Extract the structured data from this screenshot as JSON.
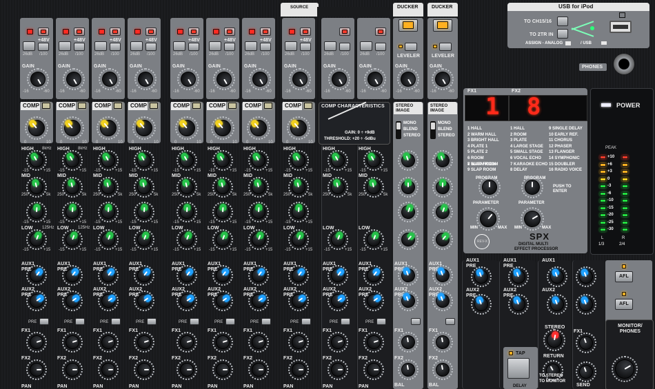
{
  "headers": {
    "source": "SOURCE",
    "ducker_1": "DUCKER",
    "ducker_2": "DUCKER",
    "usb_title": "USB for iPod"
  },
  "usb": {
    "to_ch": "TO CH15/16",
    "to_2tr": "TO 2TR IN",
    "assign": "ASSIGN - ANALOG",
    "usb_word": "/ USB",
    "phones": "PHONES"
  },
  "input": {
    "plus48": "+48V",
    "pad": "26dB",
    "hpf": "/100",
    "gain": "GAIN",
    "gain_min": "-16",
    "gain_max": "-60",
    "comp": "COMP",
    "knob_min": "0",
    "knob_max": "10",
    "high": "HIGH",
    "high_freq": "8kHz",
    "mid": "MID",
    "mid_lo": "250",
    "mid_hi": "5k",
    "low": "LOW",
    "low_freq": "125Hz",
    "eq_min": "-15",
    "eq_max": "+15",
    "aux1": "AUX1",
    "aux2": "AUX2",
    "pre": "PRE",
    "fx1": "FX1",
    "fx2": "FX2",
    "pan": "PAN"
  },
  "leveler": "LEVELER",
  "comp_characteristics": {
    "title": "COMP CHARACTERISTICS",
    "gain": "GAIN:  0 ÷ +9dB",
    "threshold": "THRESHOLD: +20 ÷ -5dBu"
  },
  "stereo": {
    "title1": "STEREO",
    "title2": "IMAGE",
    "mono": "MONO",
    "blend": "BLEND",
    "stereo": "STEREO",
    "bal": "BAL"
  },
  "fx": {
    "fx1_label": "FX1",
    "fx2_label": "FX2",
    "fx1_display": "1",
    "fx2_display": "8",
    "programs_col1": [
      "1 HALL",
      "2 WARM HALL",
      "3 BRIGHT HALL",
      "4 PLATE 1",
      "5 PLATE 2",
      "6 ROOM",
      "7 SLAP ROOM"
    ],
    "programs_col2": [
      "1 HALL",
      "2 ROOM",
      "3 PLATE",
      "4 LARGE STAGE",
      "5 SMALL STAGE",
      "6 VOCAL ECHO",
      "7 KARAOKE ECHO",
      "8 DELAY"
    ],
    "programs_col3": [
      "9 SINGLE DELAY",
      "10 EARLY REF.",
      "11 CHORUS",
      "12 PHASER",
      "13 FLANGER",
      "14 SYMPHONIC",
      "15 DOUBLER",
      "16 RADIO VOICE"
    ],
    "fx1_programs_extra": [
      "8 WARM ROOM",
      "9 SLAP ROOM"
    ],
    "program": "PROGRAM",
    "push_to_enter": "PUSH TO ENTER",
    "parameter": "PARAMETER",
    "min": "MIN",
    "max": "MAX",
    "rev_x": "REV-X",
    "spx_logo": "SPX",
    "spx_sub1": "DIGITAL MULTI",
    "spx_sub2": "EFFECT PROCESSOR"
  },
  "power": "POWER",
  "meter": {
    "peak": "PEAK",
    "scale": [
      "+10",
      "+6",
      "+3",
      "0",
      "-3",
      "-6",
      "-10",
      "-15",
      "-20",
      "-25",
      "-30"
    ],
    "l": "L",
    "r": "R",
    "l_sub": "1/3",
    "r_sub": "2/4"
  },
  "master": {
    "aux1": "AUX1",
    "aux2": "AUX2",
    "pre": "PRE",
    "afl": "AFL",
    "stereo": "STEREO",
    "return": "RETURN",
    "fx1": "FX1",
    "send": "SEND",
    "monitor_phones": "MONITOR/ PHONES",
    "tap": "TAP",
    "to_stereo": "TO STEREO",
    "to_monitor": "TO MONITOR",
    "delay": "DELAY"
  },
  "colors": {
    "comp_knob": "#f0d020",
    "eq_knob": "#27c24a",
    "aux_knob": "#1fa0ff",
    "pan_knob": "#ff3030",
    "led_red": "#ff2b22",
    "led_amber": "#ffb020"
  }
}
